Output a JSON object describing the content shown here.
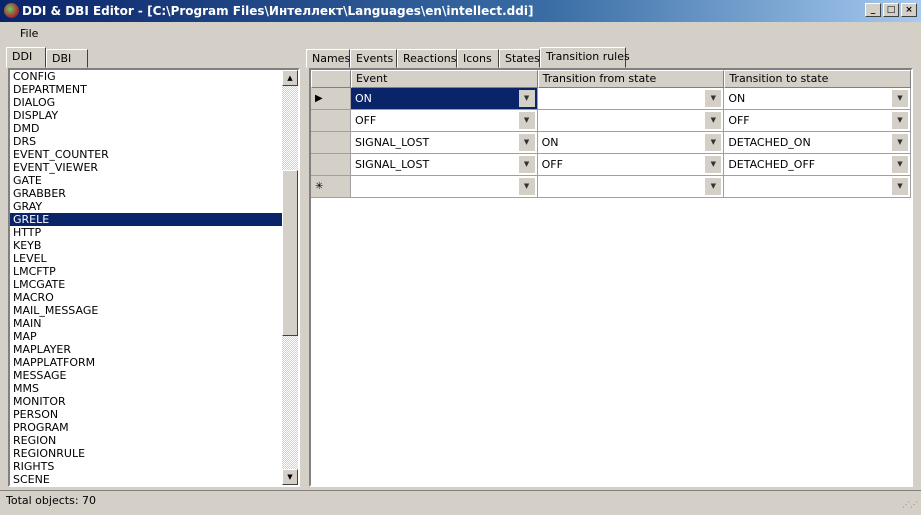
{
  "window": {
    "title": "DDI & DBI Editor - [C:\\Program Files\\Интеллект\\Languages\\en\\intellect.ddi]",
    "minimize": "_",
    "maximize": "□",
    "close": "×"
  },
  "menu": [
    "File"
  ],
  "left_tabs": [
    "DDI",
    "DBI"
  ],
  "list": {
    "items": [
      "CONFIG",
      "DEPARTMENT",
      "DIALOG",
      "DISPLAY",
      "DMD",
      "DRS",
      "EVENT_COUNTER",
      "EVENT_VIEWER",
      "GATE",
      "GRABBER",
      "GRAY",
      "GRELE",
      "HTTP",
      "KEYB",
      "LEVEL",
      "LMCFTP",
      "LMCGATE",
      "MACRO",
      "MAIL_MESSAGE",
      "MAIN",
      "MAP",
      "MAPLAYER",
      "MAPPLATFORM",
      "MESSAGE",
      "MMS",
      "MONITOR",
      "PERSON",
      "PROGRAM",
      "REGION",
      "REGIONRULE",
      "RIGHTS",
      "SCENE"
    ],
    "selected": "GRELE",
    "up": "▲",
    "down": "▼"
  },
  "right_tabs": [
    "Names",
    "Events",
    "Reactions",
    "Icons",
    "States",
    "Transition rules"
  ],
  "active_tab": "Transition rules",
  "grid": {
    "headers": [
      "Event",
      "Transition from state",
      "Transition to state"
    ],
    "rows": [
      {
        "marker": "▶",
        "event": "ON",
        "from": "",
        "to": "ON"
      },
      {
        "marker": "",
        "event": "OFF",
        "from": "",
        "to": "OFF"
      },
      {
        "marker": "",
        "event": "SIGNAL_LOST",
        "from": "ON",
        "to": "DETACHED_ON"
      },
      {
        "marker": "",
        "event": "SIGNAL_LOST",
        "from": "OFF",
        "to": "DETACHED_OFF"
      },
      {
        "marker": "✳",
        "event": "",
        "from": "",
        "to": ""
      }
    ],
    "dropdown": "▼"
  },
  "status": "Total objects: 70"
}
